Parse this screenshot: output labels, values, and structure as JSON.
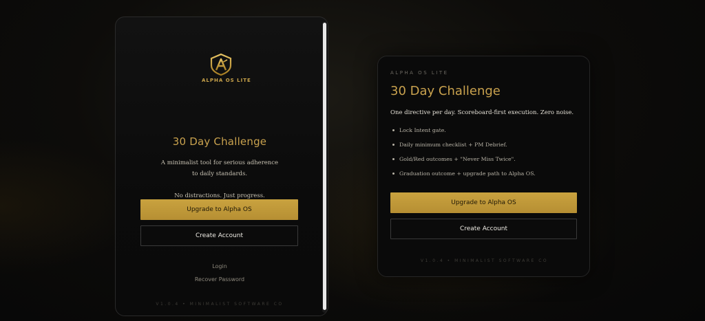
{
  "phone": {
    "logo_text": "ALPHA OS LITE",
    "title": "30 Day Challenge",
    "desc_line1": "A minimalist tool for serious adherence",
    "desc_line2": "to daily standards.",
    "desc_line3": "No distractions. Just progress.",
    "upgrade_label": "Upgrade to Alpha OS",
    "create_label": "Create Account",
    "login_label": "Login",
    "recover_label": "Recover Password",
    "footer": "V1.0.4 • MINIMALIST SOFTWARE CO"
  },
  "card": {
    "eyebrow": "ALPHA OS LITE",
    "title": "30 Day Challenge",
    "subtitle": "One directive per day. Scoreboard-first execution. Zero noise.",
    "features": [
      "Lock Intent gate.",
      "Daily minimum checklist + PM Debrief.",
      "Gold/Red outcomes + \"Never Miss Twice\".",
      "Graduation outcome + upgrade path to Alpha OS."
    ],
    "upgrade_label": "Upgrade to Alpha OS",
    "create_label": "Create Account",
    "footer": "V1.0.4 • MINIMALIST SOFTWARE CO"
  },
  "colors": {
    "accent_gold": "#c9a23f",
    "title_gold": "#c9a24e",
    "background": "#0a0a0a"
  },
  "icons": {
    "logo": "shield-a-logo-icon"
  }
}
